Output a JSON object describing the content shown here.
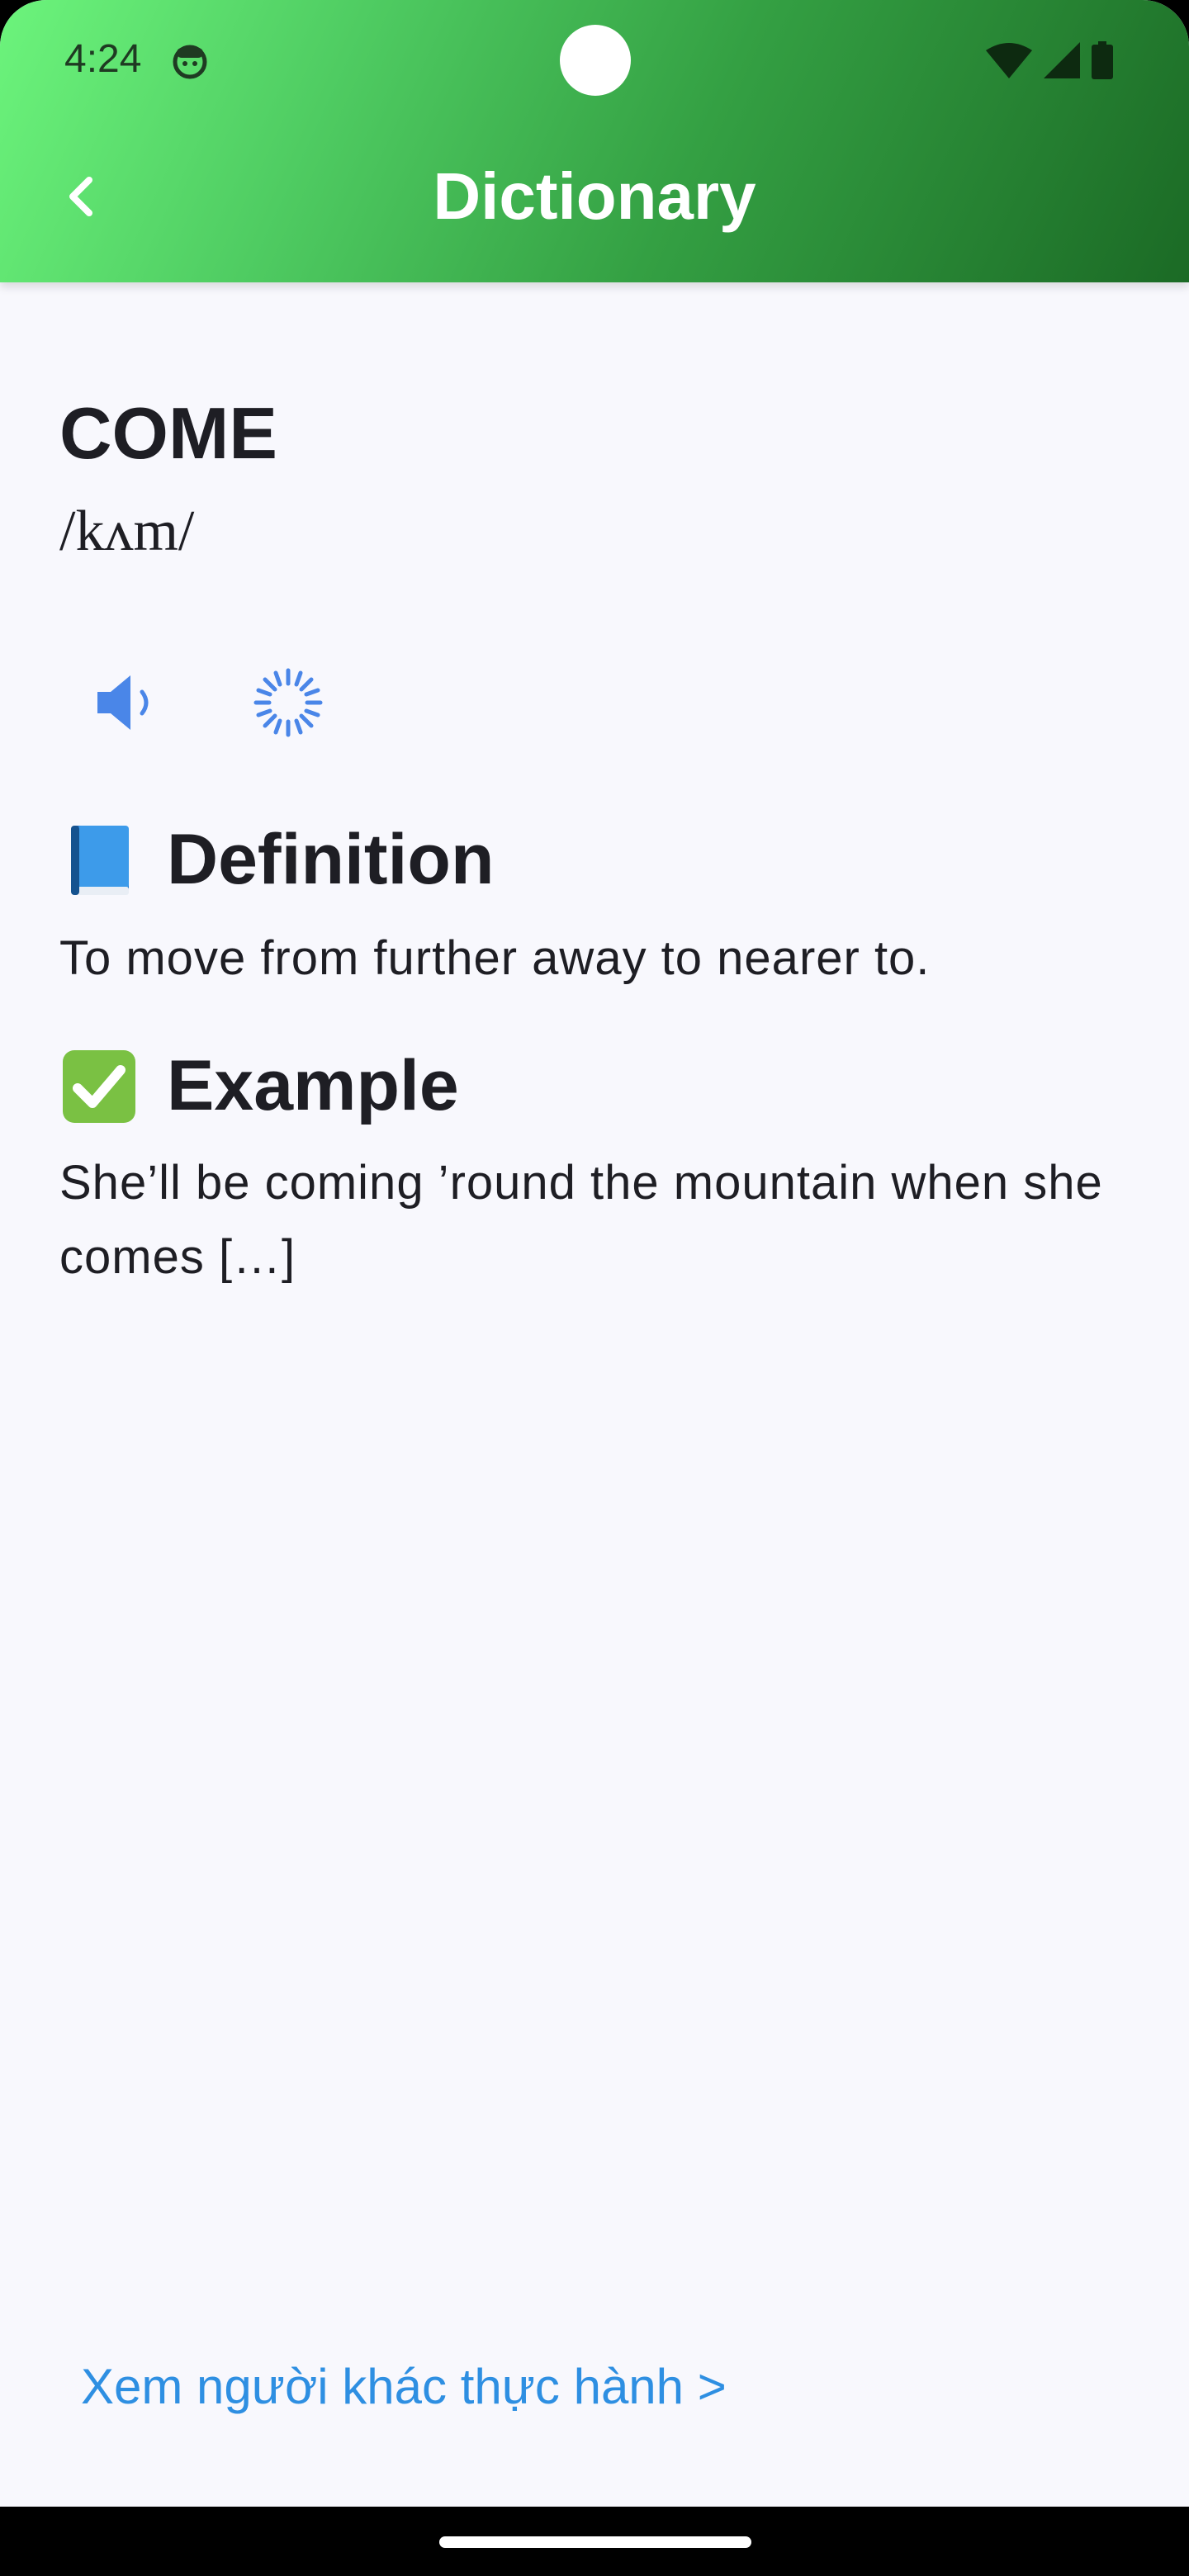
{
  "status_bar": {
    "time": "4:24",
    "icons": [
      "face-icon",
      "wifi-icon",
      "signal-icon",
      "battery-icon"
    ]
  },
  "header": {
    "back_icon": "chevron-left-icon",
    "title": "Dictionary"
  },
  "entry": {
    "word": "COME",
    "phonetic": "/kʌm/",
    "audio_icon": "speaker-icon",
    "loading_icon": "spinner-icon"
  },
  "definition": {
    "icon": "blue-book-icon",
    "heading": "Definition",
    "text": "To move from further away to nearer to."
  },
  "example": {
    "icon": "check-mark-icon",
    "heading": "Example",
    "text": "She’ll be coming ’round the mountain when she comes […]"
  },
  "footer": {
    "practice_link": "Xem người khác thực hành >"
  },
  "colors": {
    "header_gradient_start": "#6cf47c",
    "header_gradient_end": "#1b6a25",
    "accent_blue": "#2e8fe2",
    "icon_blue": "#4a86e8",
    "background": "#f8f8fd"
  }
}
